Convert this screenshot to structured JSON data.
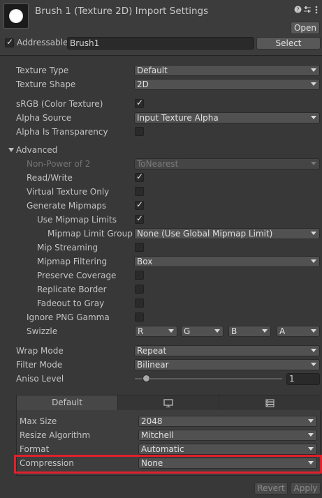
{
  "header": {
    "title": "Brush 1 (Texture 2D) Import Settings",
    "open_label": "Open",
    "addressable_label": "Addressable",
    "addressable_checked": true,
    "address_value": "Brush1",
    "select_label": "Select"
  },
  "icons": {
    "help": "help-icon",
    "presets": "presets-icon",
    "more": "more-icon"
  },
  "settings": {
    "texture_type": {
      "label": "Texture Type",
      "value": "Default"
    },
    "texture_shape": {
      "label": "Texture Shape",
      "value": "2D"
    },
    "srgb": {
      "label": "sRGB (Color Texture)",
      "checked": true
    },
    "alpha_source": {
      "label": "Alpha Source",
      "value": "Input Texture Alpha"
    },
    "alpha_is_transparency": {
      "label": "Alpha Is Transparency",
      "checked": false
    },
    "advanced_label": "Advanced",
    "non_power_of_2": {
      "label": "Non-Power of 2",
      "value": "ToNearest"
    },
    "read_write": {
      "label": "Read/Write",
      "checked": true
    },
    "virtual_texture_only": {
      "label": "Virtual Texture Only",
      "checked": false
    },
    "generate_mipmaps": {
      "label": "Generate Mipmaps",
      "checked": true
    },
    "use_mipmap_limits": {
      "label": "Use Mipmap Limits",
      "checked": true
    },
    "mipmap_limit_group": {
      "label": "Mipmap Limit Group",
      "value": "None (Use Global Mipmap Limit)"
    },
    "mip_streaming": {
      "label": "Mip Streaming",
      "checked": false
    },
    "mipmap_filtering": {
      "label": "Mipmap Filtering",
      "value": "Box"
    },
    "preserve_coverage": {
      "label": "Preserve Coverage",
      "checked": false
    },
    "replicate_border": {
      "label": "Replicate Border",
      "checked": false
    },
    "fadeout_to_gray": {
      "label": "Fadeout to Gray",
      "checked": false
    },
    "ignore_png_gamma": {
      "label": "Ignore PNG Gamma",
      "checked": false
    },
    "swizzle": {
      "label": "Swizzle",
      "values": [
        "R",
        "G",
        "B",
        "A"
      ]
    },
    "wrap_mode": {
      "label": "Wrap Mode",
      "value": "Repeat"
    },
    "filter_mode": {
      "label": "Filter Mode",
      "value": "Bilinear"
    },
    "aniso_level": {
      "label": "Aniso Level",
      "value": "1"
    }
  },
  "platform": {
    "tabs": [
      "Default",
      "monitor-icon",
      "grid-icon"
    ],
    "max_size": {
      "label": "Max Size",
      "value": "2048"
    },
    "resize_algorithm": {
      "label": "Resize Algorithm",
      "value": "Mitchell"
    },
    "format": {
      "label": "Format",
      "value": "Automatic"
    },
    "compression": {
      "label": "Compression",
      "value": "None"
    }
  },
  "footer": {
    "revert_label": "Revert",
    "apply_label": "Apply"
  },
  "colors": {
    "highlight": "#e0202b"
  }
}
